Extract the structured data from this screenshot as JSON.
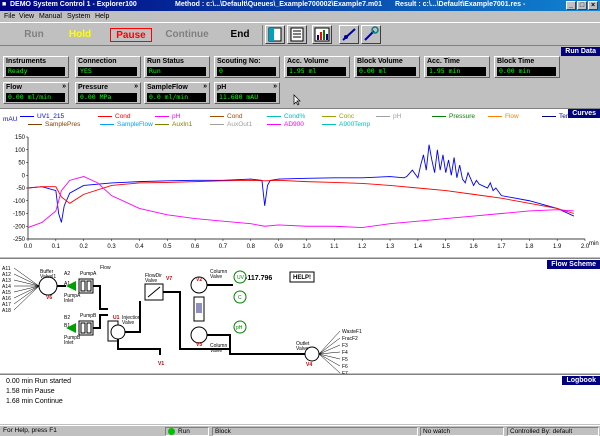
{
  "titlebar": {
    "app_title": "DEMO System Control 1 - Explorer100",
    "method": "Method : c:\\...\\Default\\Queues\\_Example700002\\Example7.m01",
    "result": "Result : c:\\...\\Default\\Example7001.res -"
  },
  "menu": [
    "File",
    "View",
    "Manual",
    "System",
    "Help"
  ],
  "toolbar": {
    "run": "Run",
    "hold": "Hold",
    "pause": "Pause",
    "continue": "Continue",
    "end": "End"
  },
  "run_data": {
    "title": "Run Data",
    "fields": [
      {
        "label": "Instruments",
        "value": "Ready"
      },
      {
        "label": "Connection",
        "value": "YES"
      },
      {
        "label": "Run Status",
        "value": "Run"
      },
      {
        "label": "Scouting No:",
        "value": "0"
      },
      {
        "label": "Acc. Volume",
        "value": "1.95 ml"
      },
      {
        "label": "Block Volume",
        "value": "0.00 ml"
      },
      {
        "label": "Acc. Time",
        "value": "1.95 min"
      },
      {
        "label": "Block Time",
        "value": "0.00 min"
      },
      {
        "label": "Flow",
        "value": "0.00 ml/min"
      },
      {
        "label": "Pressure",
        "value": "0.00 MPa"
      },
      {
        "label": "SampleFlow",
        "value": "0.0 ml/min"
      },
      {
        "label": "pH",
        "value": "11.680 mAU"
      }
    ]
  },
  "curves": {
    "title": "Curves",
    "legend": [
      {
        "name": "UV1_215",
        "color": "#0000ff"
      },
      {
        "name": "Cond",
        "color": "#ff0000"
      },
      {
        "name": "pH",
        "color": "#ff00ff"
      },
      {
        "name": "Cond",
        "color": "#a05000"
      },
      {
        "name": "Cond%",
        "color": "#00c0c0"
      },
      {
        "name": "Conc",
        "color": "#a0a000"
      },
      {
        "name": "pH",
        "color": "#a0a0a0"
      },
      {
        "name": "Pressure",
        "color": "#008000"
      },
      {
        "name": "Flow",
        "color": "#ff8000"
      },
      {
        "name": "Tem",
        "color": "#000080"
      },
      {
        "name": "SamplePres",
        "color": "#804000"
      },
      {
        "name": "SampleFlow",
        "color": "#00a0ff"
      },
      {
        "name": "AuxIn1",
        "color": "#808000"
      },
      {
        "name": "AuxOut1",
        "color": "#a0a0a0"
      },
      {
        "name": "AD900",
        "color": "#ff00ff"
      },
      {
        "name": "A900Temp",
        "color": "#00c0c0"
      }
    ],
    "y_unit": "mAU",
    "x_unit": "min"
  },
  "chart_data": {
    "type": "line",
    "xlabel": "min",
    "ylabel": "mAU",
    "xlim": [
      0.0,
      2.0
    ],
    "ylim": [
      -250,
      150
    ],
    "x_ticks": [
      "0.0",
      "0.1",
      "0.2",
      "0.3",
      "0.4",
      "0.5",
      "0.6",
      "0.7",
      "0.8",
      "0.9",
      "1.0",
      "1.1",
      "1.2",
      "1.3",
      "1.4",
      "1.5",
      "1.6",
      "1.7",
      "1.8",
      "1.9",
      "2.0"
    ],
    "y_ticks": [
      "150",
      "100",
      "50",
      "0",
      "-50",
      "-100",
      "-150",
      "-200",
      "-250"
    ],
    "series": [
      {
        "name": "UV1_215",
        "color": "#0000ff",
        "x": [
          0.0,
          0.05,
          0.1,
          0.11,
          0.12,
          0.13,
          0.15,
          0.2,
          0.3,
          0.4,
          0.5,
          0.6,
          0.7,
          0.8,
          0.84,
          0.85,
          0.86,
          0.87,
          0.9,
          1.0,
          1.1,
          1.2,
          1.3,
          1.35,
          1.36,
          1.38,
          1.4,
          1.41,
          1.42,
          1.43,
          1.44,
          1.45,
          1.46,
          1.47,
          1.48,
          1.49,
          1.5,
          1.51,
          1.52,
          1.53,
          1.54,
          1.55,
          1.56,
          1.57,
          1.58,
          1.6,
          1.61,
          1.62,
          1.63,
          1.65,
          1.66,
          1.67,
          1.68,
          1.7,
          1.8,
          1.9,
          1.96
        ],
        "y": [
          -50,
          -45,
          -60,
          -150,
          -185,
          -120,
          -70,
          -40,
          -30,
          -25,
          -22,
          -20,
          -20,
          -15,
          -20,
          -120,
          -40,
          -20,
          -15,
          -12,
          -10,
          -10,
          -5,
          -10,
          -5,
          20,
          -10,
          40,
          80,
          20,
          120,
          60,
          10,
          100,
          20,
          80,
          10,
          60,
          0,
          70,
          -10,
          40,
          -15,
          -30,
          10,
          -40,
          -20,
          -35,
          -40,
          -50,
          -30,
          -60,
          -50,
          -80,
          -100,
          -130,
          -160
        ]
      },
      {
        "name": "Cond",
        "color": "#ff0000",
        "x": [
          0.0,
          0.05,
          0.1,
          0.12,
          0.15,
          0.2,
          0.3,
          0.4,
          0.5,
          0.6,
          0.7,
          0.8,
          0.85,
          0.9,
          1.0,
          1.1,
          1.2,
          1.3,
          1.4,
          1.5,
          1.6,
          1.7,
          1.8,
          1.9,
          1.96
        ],
        "y": [
          -50,
          -45,
          -45,
          -85,
          -110,
          -75,
          -40,
          -30,
          -28,
          -25,
          -22,
          -20,
          -22,
          -20,
          -25,
          -28,
          -32,
          -40,
          -50,
          -60,
          -75,
          -90,
          -110,
          -130,
          -150
        ]
      },
      {
        "name": "pH",
        "color": "#ff00ff",
        "x": [
          0.0,
          0.05,
          0.1,
          0.12,
          0.15,
          0.2,
          0.25,
          0.3,
          0.4,
          0.5,
          0.6,
          0.7,
          0.8,
          0.85,
          0.9,
          1.0,
          1.1,
          1.2,
          1.3,
          1.4,
          1.5,
          1.6,
          1.7,
          1.8,
          1.9,
          1.96
        ],
        "y": [
          -205,
          -185,
          -140,
          -60,
          -20,
          -5,
          -30,
          -80,
          -130,
          -155,
          -170,
          -180,
          -190,
          -200,
          -195,
          -200,
          -200,
          -205,
          -190,
          -180,
          -170,
          -160,
          -150,
          -140,
          -135,
          -140
        ]
      }
    ]
  },
  "flow_scheme": {
    "title": "Flow Scheme",
    "inlets_a": [
      "A11",
      "A12",
      "A13",
      "A14",
      "A15",
      "A16",
      "A17",
      "A18"
    ],
    "inlets_b": [
      "B1",
      "B2"
    ],
    "outlets": [
      "WasteF1",
      "FracF2",
      "F3",
      "F4",
      "F5",
      "F6",
      "F7"
    ],
    "labels": {
      "buffer_valve": "Buffer Valve|1",
      "v6": "V6",
      "pump_a": "PumpA",
      "pump_b": "PumpB",
      "flow": "Flow",
      "flowdir_valve": "FlowDir Valve",
      "v7": "V7",
      "column_valve_1": "Column Valve",
      "column_valve_2": "Column Valve",
      "v2": "V2",
      "v3": "V3",
      "u1": "U1",
      "injection_valve": "Injection Valve",
      "v1": "V1",
      "uv": "UV",
      "c": "C",
      "ph": "pH",
      "outlet_valve": "Outlet Valve",
      "v4": "V4",
      "readout": "-117.796",
      "help": "HELP!"
    }
  },
  "logbook": {
    "title": "Logbook",
    "entries": [
      "0.00 min Run started",
      "1.58 min Pause",
      "1.68 min Continue"
    ]
  },
  "statusbar": {
    "help": "For Help, press F1",
    "run": "Run",
    "block": "Block",
    "watch": "No watch",
    "controlled": "Controlled By: default"
  }
}
